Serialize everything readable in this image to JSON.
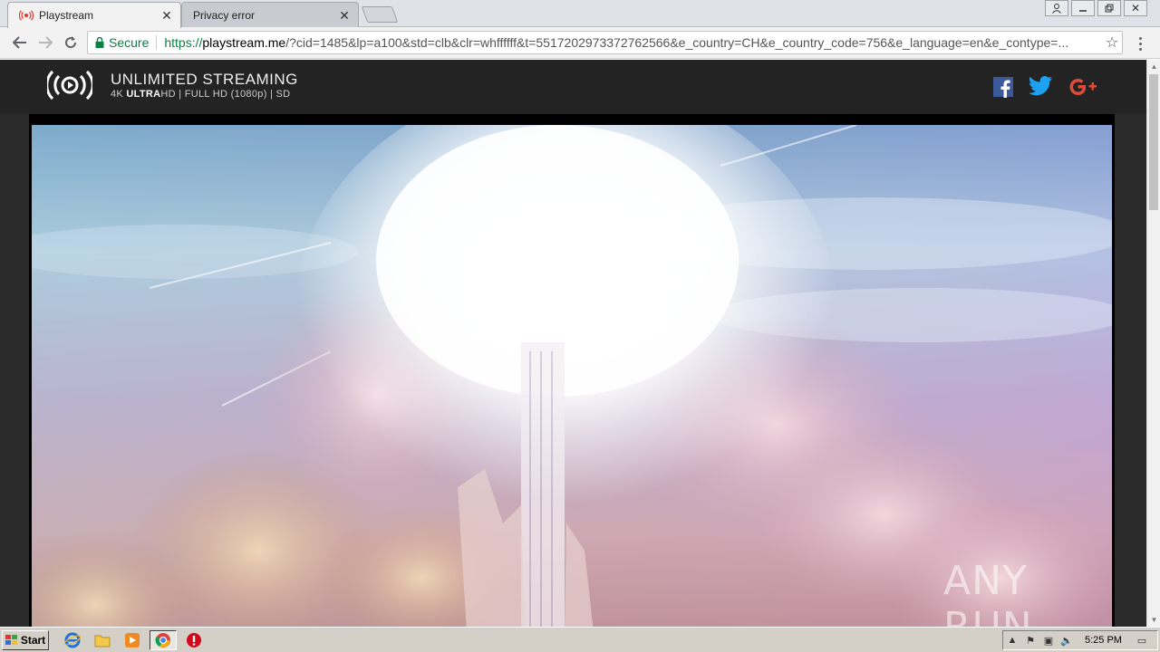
{
  "browser": {
    "tabs": [
      {
        "title": "Playstream",
        "active": true
      },
      {
        "title": "Privacy error",
        "active": false
      }
    ],
    "address": {
      "secure_label": "Secure",
      "scheme": "https://",
      "host": "playstream.me",
      "path": "/?cid=1485&lp=a100&std=clb&clr=whffffff&t=5517202973372762566&e_country=CH&e_country_code=756&e_language=en&e_contype=..."
    }
  },
  "site": {
    "title": "UNLIMITED STREAMING",
    "sub_4k": "4K ",
    "sub_ultra": "ULTRA",
    "sub_rest": "HD | FULL HD (1080p) | SD"
  },
  "watermark": "ANY RUN",
  "taskbar": {
    "start_label": "Start",
    "clock": "5:25 PM"
  },
  "colors": {
    "secure_green": "#0b8043",
    "facebook": "#3b5998",
    "twitter": "#1da1f2",
    "google_plus": "#dd4b39"
  }
}
